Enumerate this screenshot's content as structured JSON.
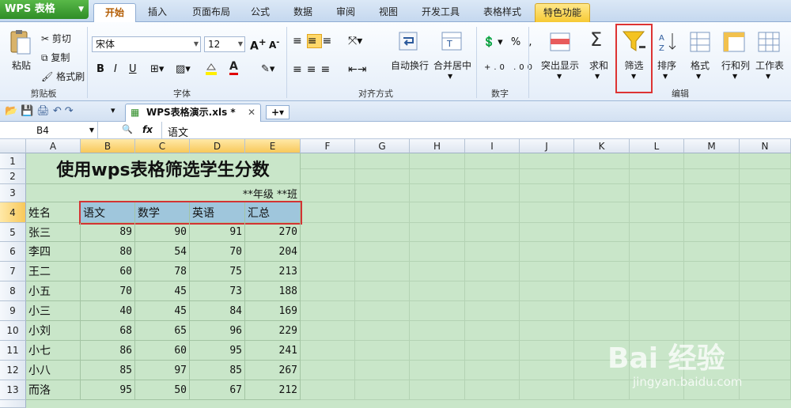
{
  "app": {
    "name": "WPS 表格"
  },
  "tabs": [
    "开始",
    "插入",
    "页面布局",
    "公式",
    "数据",
    "审阅",
    "视图",
    "开发工具",
    "表格样式",
    "特色功能"
  ],
  "clipboard": {
    "paste": "粘贴",
    "cut": "剪切",
    "copy": "复制",
    "format_painter": "格式刷",
    "group": "剪贴板"
  },
  "font": {
    "name": "宋体",
    "size": "12",
    "group": "字体"
  },
  "align": {
    "wrap": "自动换行",
    "merge": "合并居中",
    "group": "对齐方式"
  },
  "number": {
    "group": "数字"
  },
  "edit": {
    "highlight": "突出显示",
    "sum": "求和",
    "filter": "筛选",
    "sort": "排序",
    "format": "格式",
    "rowcol": "行和列",
    "sheet": "工作表",
    "group": "编辑"
  },
  "doc": {
    "tab_title": "WPS表格演示.xls *"
  },
  "formula": {
    "cell_ref": "B4",
    "fx": "fx",
    "value": "语文"
  },
  "columns": [
    "A",
    "B",
    "C",
    "D",
    "E",
    "F",
    "G",
    "H",
    "I",
    "J",
    "K",
    "L",
    "M",
    "N"
  ],
  "rows": [
    "1",
    "2",
    "3",
    "4",
    "5",
    "6",
    "7",
    "8",
    "9",
    "10",
    "11",
    "12",
    "13"
  ],
  "sheet": {
    "title": "使用wps表格筛选学生分数",
    "subtitle": "**年级 **班",
    "headers": [
      "姓名",
      "语文",
      "数学",
      "英语",
      "汇总"
    ],
    "students": [
      {
        "name": "张三",
        "chinese": "89",
        "math": "90",
        "english": "91",
        "total": "270"
      },
      {
        "name": "李四",
        "chinese": "80",
        "math": "54",
        "english": "70",
        "total": "204"
      },
      {
        "name": "王二",
        "chinese": "60",
        "math": "78",
        "english": "75",
        "total": "213"
      },
      {
        "name": "小五",
        "chinese": "70",
        "math": "45",
        "english": "73",
        "total": "188"
      },
      {
        "name": "小三",
        "chinese": "40",
        "math": "45",
        "english": "84",
        "total": "169"
      },
      {
        "name": "小刘",
        "chinese": "68",
        "math": "65",
        "english": "96",
        "total": "229"
      },
      {
        "name": "小七",
        "chinese": "86",
        "math": "60",
        "english": "95",
        "total": "241"
      },
      {
        "name": "小八",
        "chinese": "85",
        "math": "97",
        "english": "85",
        "total": "267"
      },
      {
        "name": "而洛",
        "chinese": "95",
        "math": "50",
        "english": "67",
        "total": "212"
      }
    ]
  },
  "watermark": {
    "brand": "Bai 经验",
    "url": "jingyan.baidu.com"
  },
  "colors": {
    "accent_green": "#2f8d27",
    "grid_bg": "#c9e6c9",
    "header_fill": "#9fc6dc",
    "highlight_red": "#d33333"
  }
}
